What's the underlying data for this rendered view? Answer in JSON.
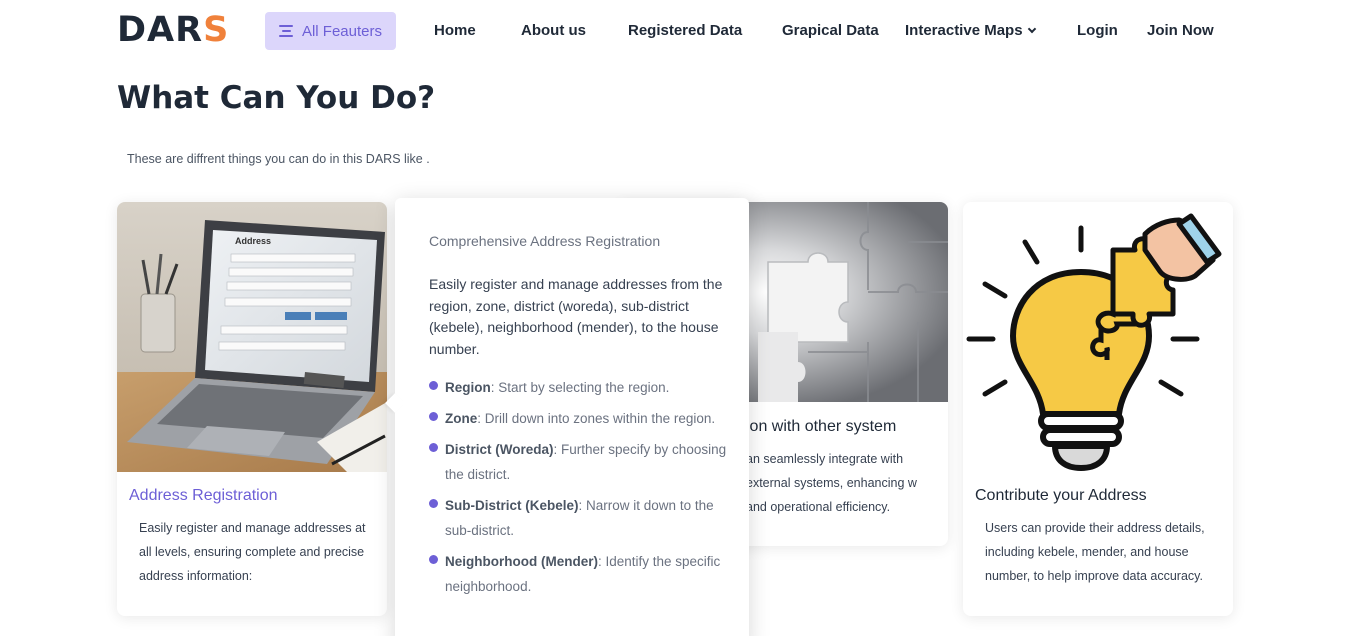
{
  "brand": {
    "logo_main": "DAR",
    "logo_accent": "S",
    "accent_color": "#f0813b",
    "primary_color": "#6d5fd6"
  },
  "header": {
    "features_button": "All Feauters",
    "nav": {
      "home": "Home",
      "about": "About us",
      "registered": "Registered Data",
      "graphical": "Grapical Data",
      "maps": "Interactive Maps",
      "login": "Login",
      "join": "Join Now"
    }
  },
  "main": {
    "title": "What Can You Do?",
    "subtitle": "These are diffrent things you can do in this DARS like ."
  },
  "cards": [
    {
      "title": "Address Registration",
      "description": "Easily register and manage addresses at all levels, ensuring complete and precise address information:"
    },
    {
      "title": "ion with other system",
      "description": "an seamlessly integrate with external systems, enhancing w and operational efficiency."
    },
    {
      "title": "Contribute your Address",
      "description": "Users can provide their address details, including kebele, mender, and house number, to help improve data accuracy."
    }
  ],
  "popup": {
    "heading": "Comprehensive Address Registration",
    "description": "Easily register and manage addresses from the region, zone, district (woreda), sub-district (kebele), neighborhood (mender), to the house number.",
    "items": [
      {
        "term": "Region",
        "text": ": Start by selecting the region."
      },
      {
        "term": "Zone",
        "text": ": Drill down into zones within the region."
      },
      {
        "term": "District (Woreda)",
        "text": ": Further specify by choosing the district."
      },
      {
        "term": "Sub-District (Kebele)",
        "text": ": Narrow it down to the sub-district."
      },
      {
        "term": "Neighborhood (Mender)",
        "text": ": Identify the specific neighborhood."
      }
    ]
  },
  "images": {
    "laptop": {
      "form_title": "Address"
    }
  }
}
